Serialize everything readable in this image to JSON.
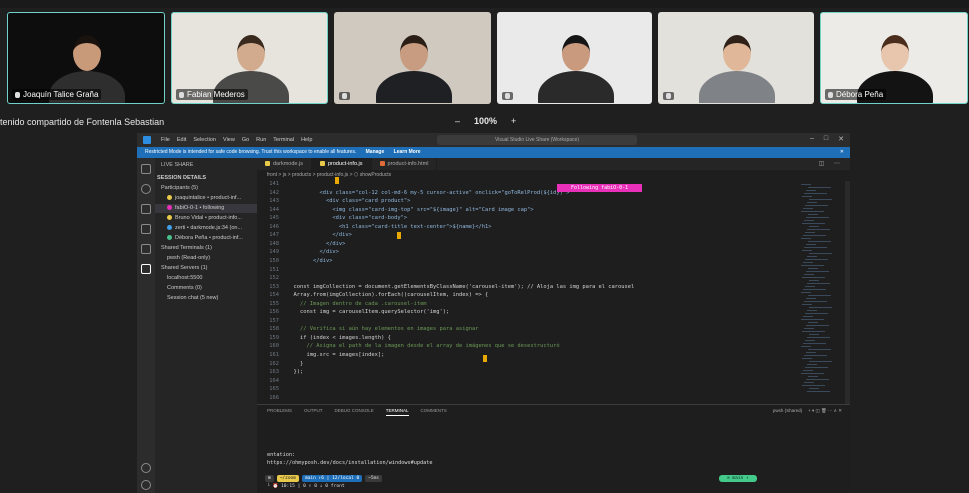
{
  "participants": [
    {
      "name": "Joaquín Talice Graña",
      "bg": "#0d0d0d",
      "skin": "#c99a7a",
      "hair": "#1a120c",
      "shirt": "#2e2e2e"
    },
    {
      "name": "Fabian Mederos",
      "bg": "#e7e4de",
      "skin": "#d2ab8f",
      "hair": "#3a2a1d",
      "shirt": "#4a4a48"
    },
    {
      "name": "",
      "bg": "#cfc9c0",
      "skin": "#c79c80",
      "hair": "#2a1e16",
      "shirt": "#1f2024"
    },
    {
      "name": "",
      "bg": "#eaeaea",
      "skin": "#c99a7d",
      "hair": "#151515",
      "shirt": "#2a2a2a"
    },
    {
      "name": "",
      "bg": "#e3e1dc",
      "skin": "#e0b899",
      "hair": "#2f2118",
      "shirt": "#7f8286"
    },
    {
      "name": "Débora Peña",
      "bg": "#ecebe7",
      "skin": "#e7c6ad",
      "hair": "#4a2d1c",
      "shirt": "#131313"
    }
  ],
  "share_bar": {
    "label": "tenido compartido de Fontenla Sebastian",
    "zoom_out": "–",
    "zoom": "100%",
    "zoom_in": "+"
  },
  "vscode": {
    "menus": [
      "File",
      "Edit",
      "Selection",
      "View",
      "Go",
      "Run",
      "Terminal",
      "Help"
    ],
    "search": "Visual Studio Live Share (Workspace)",
    "restricted": "Restricted Mode is intended for safe code browsing. Trust this workspace to enable all features.",
    "manage": "Manage",
    "learn": "Learn More",
    "sidebar": {
      "title": "LIVE SHARE",
      "session": "SESSION DETAILS",
      "participants_header": "Participants (5)",
      "participants": [
        "joaquintalice • product-inf...",
        "fabiO-0-1 • following",
        "Bruno Vidal • product-info...",
        "zerti • darkmode.js:34 (on...",
        "Débora Peña • product-inf..."
      ],
      "terminals_header": "Shared Terminals (1)",
      "terminal": "pwsh (Read-only)",
      "servers_header": "Shared Servers (1)",
      "server": "localhost:5500",
      "comments": "Comments (0)",
      "chat": "Session chat (5 new)"
    },
    "tabs": [
      "darkmode.js",
      "product-info.js",
      "product-info.html"
    ],
    "breadcrumb": "front > js > products > product-info.js > ⬡ showProducts",
    "follow_badge": "Following fabiO-0-1",
    "line_numbers": [
      "141",
      "142",
      "143",
      "144",
      "145",
      "146",
      "147",
      "148",
      "149",
      "150",
      "151",
      "152",
      "153",
      "154",
      "155",
      "156",
      "157",
      "158",
      "159",
      "160",
      "161",
      "162",
      "163",
      "164",
      "165",
      "166"
    ],
    "code_lines": [
      "",
      "          <div class=\"col-12 col-md-6 my-5 cursor-active\" onclick=\"goToRelProd(${id})\">",
      "            <div class=\"card product\">",
      "              <img class=\"card-img-top\" src=\"${image}\" alt=\"Card image cap\">",
      "              <div class=\"card-body\">",
      "                <h1 class=\"card-title text-center\">${name}</h1>",
      "              </div>",
      "            </div>",
      "          </div>",
      "        </div>",
      "",
      "",
      "  const imgCollection = document.getElementsByClassName('carousel-item'); // Aloja las img para el carousel",
      "  Array.from(imgCollection).forEach((carouselItem, index) => {",
      "    // Imagen dentro de cada .carousel-item",
      "    const img = carouselItem.querySelector('img');",
      "",
      "    // Verifica si aún hay elementos en images para asignar",
      "    if (index < images.length) {",
      "      // Asigna el path de la imagen desde el array de imágenes que se desestructuró",
      "      img.src = images[index];",
      "    }",
      "  });",
      "",
      "",
      ""
    ],
    "panel_tabs": [
      "PROBLEMS",
      "OUTPUT",
      "DEBUG CONSOLE",
      "TERMINAL",
      "COMMENTS"
    ],
    "terminal_name": "pwsh (Shared)",
    "terminal_lines": [
      "entation:",
      "https://ohmyposh.dev/docs/installation/windows#update"
    ],
    "prompt_segments": [
      "⊞",
      "~/zoom",
      "main ↑6 | 12/local 0",
      "~5ms"
    ],
    "prompt_time": "└ ⏰ 10:15 | 0 ↑ 0 ↓ 0 front",
    "branch": "⊙ main ↑"
  }
}
